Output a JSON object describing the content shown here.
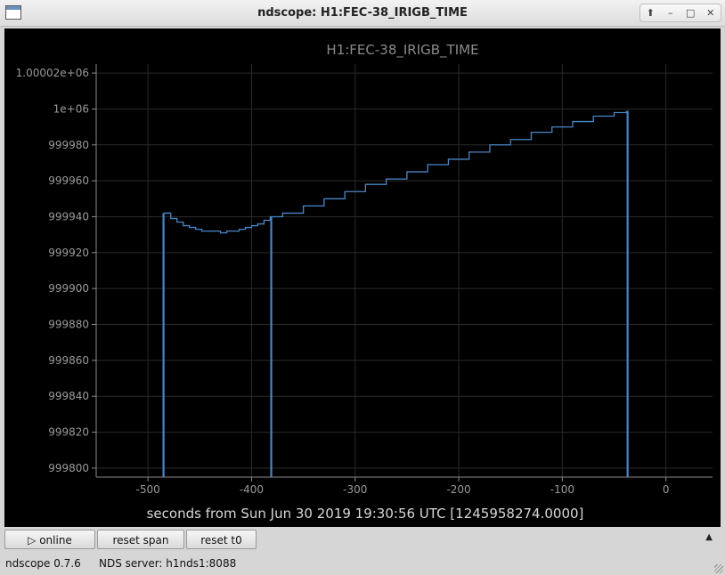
{
  "window": {
    "title": "ndscope: H1:FEC-38_IRIGB_TIME",
    "controls": [
      "⬆",
      "–",
      "□",
      "✕"
    ]
  },
  "colors": {
    "background": "#000000",
    "trace": "#4a86c8",
    "grid": "#2a2a2a",
    "axis_text": "#9a9a9a"
  },
  "chart_data": {
    "type": "line",
    "title": "H1:FEC-38_IRIGB_TIME",
    "xlabel": "seconds from Sun Jun 30 2019 19:30:56 UTC [1245958274.0000]",
    "ylabel": "",
    "xlim": [
      -550,
      45
    ],
    "ylim": [
      999795,
      1000025
    ],
    "x_ticks": [
      -500,
      -400,
      -300,
      -200,
      -100,
      0
    ],
    "x_tick_labels": [
      "-500",
      "-400",
      "-300",
      "-200",
      "-100",
      "0"
    ],
    "y_ticks": [
      999800,
      999820,
      999840,
      999860,
      999880,
      999900,
      999920,
      999940,
      999960,
      999980,
      1000000,
      1000020
    ],
    "y_tick_labels": [
      "999800",
      "999820",
      "999840",
      "999860",
      "999880",
      "999900",
      "999920",
      "999940",
      "999960",
      "999980",
      "1e+06",
      "1.00002e+06"
    ],
    "grid": true,
    "series": [
      {
        "x": [
          -485,
          -478,
          -472,
          -466,
          -460,
          -454,
          -448,
          -442,
          -436,
          -430,
          -424,
          -418,
          -412,
          -406,
          -400,
          -394,
          -388,
          -382,
          -370,
          -350,
          -330,
          -310,
          -290,
          -270,
          -250,
          -230,
          -210,
          -190,
          -170,
          -150,
          -130,
          -110,
          -90,
          -70,
          -50,
          -38
        ],
        "y": [
          999942,
          999939,
          999937,
          999935,
          999934,
          999933,
          999932,
          999932,
          999932,
          999931,
          999932,
          999932,
          999933,
          999934,
          999935,
          999936,
          999938,
          999940,
          999942,
          999946,
          999950,
          999954,
          999958,
          999961,
          999965,
          999969,
          999972,
          999976,
          999980,
          999983,
          999987,
          999990,
          999993,
          999996,
          999998,
          999999
        ]
      }
    ],
    "drops": [
      -485,
      -381,
      -37
    ]
  },
  "buttons": {
    "online": "▷ online",
    "reset_span": "reset span",
    "reset_t0": "reset t0"
  },
  "status": {
    "version": "ndscope 0.7.6",
    "server": "NDS server: h1nds1:8088"
  }
}
